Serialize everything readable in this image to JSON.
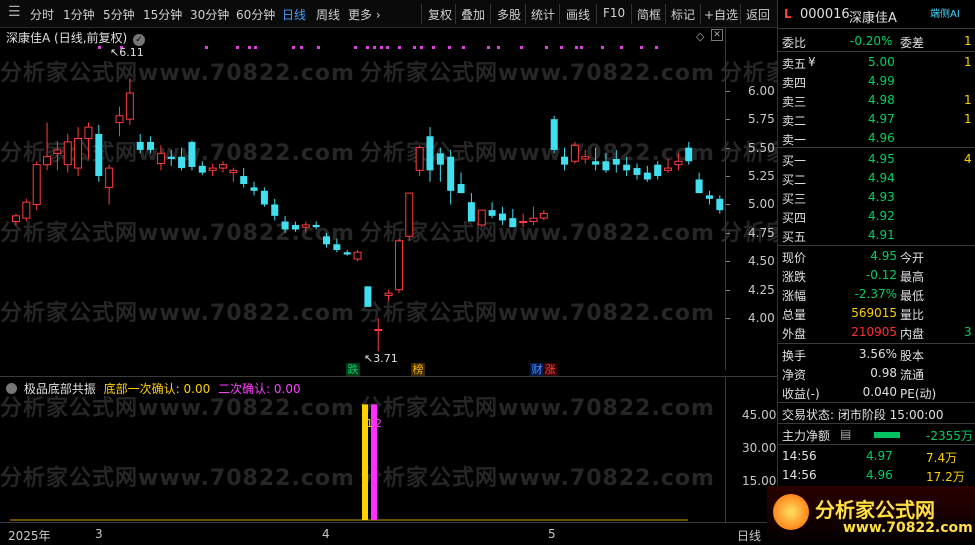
{
  "toolbar": {
    "left": [
      "分时",
      "1分钟",
      "5分钟",
      "15分钟",
      "30分钟",
      "60分钟",
      "日线",
      "周线",
      "更多 ›"
    ],
    "right": [
      "复权",
      "叠加",
      "多股",
      "统计",
      "画线",
      "F10",
      "简框",
      "标记",
      "+自选",
      "返回"
    ],
    "active": "日线"
  },
  "chart_header": {
    "title": "深康佳A (日线,前复权)",
    "badges": [
      {
        "text": "跌",
        "color": "#00c060"
      },
      {
        "text": "榜",
        "color": "#ffa000"
      },
      {
        "text": "财",
        "color": "#4080ff"
      },
      {
        "text": "涨",
        "color": "#ff3030"
      }
    ]
  },
  "price_axis": [
    "6.00",
    "5.75",
    "5.50",
    "5.25",
    "5.00",
    "4.75",
    "4.50",
    "4.25",
    "4.00"
  ],
  "annotations": {
    "high": "6.11",
    "low": "3.71"
  },
  "indicator": {
    "name": "极品底部共振",
    "label1": "底部一次确认: 0.00",
    "label2": "二次确认: 0.00",
    "bar_label1": "1",
    "bar_label2": "2",
    "axis": [
      "45.00",
      "30.00",
      "15.00"
    ],
    "bar_values": [
      50,
      50
    ]
  },
  "time_axis": [
    "2025年",
    "3",
    "4",
    "5"
  ],
  "period_label": "日线",
  "watermark": "分析家公式网www.70822.com",
  "logo": {
    "main": "分析家公式网",
    "url": "www.70822.com"
  },
  "panel": {
    "code_prefix": "L",
    "code": "000016",
    "name": "深康佳A",
    "corner": "端侧AI",
    "weibi_label": "委比",
    "weibi_val": "-0.20%",
    "weicha_label": "委差",
    "weicha_val": "1",
    "sells": [
      {
        "label": "卖五",
        "sym": "¥",
        "price": "5.00",
        "vol": "1"
      },
      {
        "label": "卖四",
        "sym": "",
        "price": "4.99",
        "vol": ""
      },
      {
        "label": "卖三",
        "sym": "",
        "price": "4.98",
        "vol": "1"
      },
      {
        "label": "卖二",
        "sym": "",
        "price": "4.97",
        "vol": "1"
      },
      {
        "label": "卖一",
        "sym": "",
        "price": "4.96",
        "vol": ""
      }
    ],
    "buys": [
      {
        "label": "买一",
        "price": "4.95",
        "vol": "4"
      },
      {
        "label": "买二",
        "price": "4.94",
        "vol": ""
      },
      {
        "label": "买三",
        "price": "4.93",
        "vol": ""
      },
      {
        "label": "买四",
        "price": "4.92",
        "vol": ""
      },
      {
        "label": "买五",
        "price": "4.91",
        "vol": ""
      }
    ],
    "stats": [
      {
        "l1": "现价",
        "v1": "4.95",
        "c1": "green",
        "l2": "今开",
        "v2": ""
      },
      {
        "l1": "涨跌",
        "v1": "-0.12",
        "c1": "green",
        "l2": "最高",
        "v2": ""
      },
      {
        "l1": "涨幅",
        "v1": "-2.37%",
        "c1": "green",
        "l2": "最低",
        "v2": ""
      },
      {
        "l1": "总量",
        "v1": "569015",
        "c1": "yellow",
        "l2": "量比",
        "v2": ""
      },
      {
        "l1": "外盘",
        "v1": "210905",
        "c1": "red",
        "l2": "内盘",
        "v2": "3"
      }
    ],
    "stats2": [
      {
        "l1": "换手",
        "v1": "3.56%",
        "l2": "股本"
      },
      {
        "l1": "净资",
        "v1": "0.98",
        "l2": "流通"
      },
      {
        "l1": "收益(-)",
        "v1": "0.040",
        "l2": "PE(动)"
      }
    ],
    "trade_state": "交易状态: 闭市阶段 15:00:00",
    "main_net_label": "主力净额",
    "main_net_val": "-2355万",
    "ticks": [
      {
        "time": "14:56",
        "price": "4.97",
        "vol": "7.4万"
      },
      {
        "time": "14:56",
        "price": "4.96",
        "vol": "17.2万"
      }
    ]
  },
  "chart_data": {
    "type": "candlestick",
    "ylim": [
      3.65,
      6.2
    ],
    "candles": [
      [
        4.85,
        4.92,
        4.82,
        4.9
      ],
      [
        4.88,
        5.05,
        4.85,
        5.02
      ],
      [
        5.0,
        5.38,
        4.95,
        5.35
      ],
      [
        5.35,
        5.72,
        5.3,
        5.42
      ],
      [
        5.45,
        5.55,
        5.3,
        5.48
      ],
      [
        5.35,
        5.62,
        5.28,
        5.55
      ],
      [
        5.32,
        5.68,
        5.25,
        5.58
      ],
      [
        5.58,
        5.72,
        5.4,
        5.68
      ],
      [
        5.62,
        5.7,
        5.2,
        5.25
      ],
      [
        5.15,
        5.35,
        5.0,
        5.32
      ],
      [
        5.72,
        5.86,
        5.6,
        5.78
      ],
      [
        5.75,
        6.11,
        5.7,
        5.98
      ],
      [
        5.55,
        5.62,
        5.45,
        5.48
      ],
      [
        5.55,
        5.6,
        5.45,
        5.48
      ],
      [
        5.36,
        5.52,
        5.3,
        5.45
      ],
      [
        5.42,
        5.48,
        5.34,
        5.4
      ],
      [
        5.42,
        5.5,
        5.3,
        5.32
      ],
      [
        5.55,
        5.56,
        5.3,
        5.33
      ],
      [
        5.34,
        5.38,
        5.26,
        5.28
      ],
      [
        5.3,
        5.36,
        5.25,
        5.32
      ],
      [
        5.32,
        5.38,
        5.28,
        5.35
      ],
      [
        5.28,
        5.32,
        5.2,
        5.3
      ],
      [
        5.25,
        5.32,
        5.15,
        5.18
      ],
      [
        5.15,
        5.2,
        5.08,
        5.12
      ],
      [
        5.12,
        5.15,
        4.98,
        5.0
      ],
      [
        5.0,
        5.05,
        4.86,
        4.9
      ],
      [
        4.85,
        4.9,
        4.75,
        4.78
      ],
      [
        4.82,
        4.85,
        4.76,
        4.78
      ],
      [
        4.8,
        4.85,
        4.75,
        4.82
      ],
      [
        4.82,
        4.85,
        4.78,
        4.8
      ],
      [
        4.72,
        4.75,
        4.62,
        4.65
      ],
      [
        4.65,
        4.7,
        4.58,
        4.6
      ],
      [
        4.58,
        4.6,
        4.55,
        4.56
      ],
      [
        4.52,
        4.6,
        4.5,
        4.58
      ],
      [
        4.28,
        4.28,
        4.1,
        4.1
      ],
      [
        3.9,
        4.0,
        3.71,
        3.9
      ],
      [
        4.2,
        4.25,
        4.15,
        4.22
      ],
      [
        4.25,
        4.7,
        4.22,
        4.68
      ],
      [
        4.72,
        5.1,
        4.68,
        5.1
      ],
      [
        5.3,
        5.52,
        5.25,
        5.5
      ],
      [
        5.6,
        5.68,
        5.2,
        5.3
      ],
      [
        5.45,
        5.5,
        5.2,
        5.35
      ],
      [
        5.42,
        5.48,
        5.0,
        5.12
      ],
      [
        5.18,
        5.28,
        5.1,
        5.1
      ],
      [
        5.02,
        5.1,
        4.85,
        4.85
      ],
      [
        4.82,
        4.95,
        4.8,
        4.95
      ],
      [
        4.95,
        5.02,
        4.88,
        4.9
      ],
      [
        4.92,
        4.98,
        4.82,
        4.86
      ],
      [
        4.88,
        4.96,
        4.8,
        4.8
      ],
      [
        4.85,
        4.92,
        4.8,
        4.85
      ],
      [
        4.85,
        4.98,
        4.82,
        4.88
      ],
      [
        4.88,
        4.95,
        4.86,
        4.92
      ],
      [
        5.75,
        5.78,
        5.45,
        5.48
      ],
      [
        5.42,
        5.5,
        5.3,
        5.35
      ],
      [
        5.38,
        5.55,
        5.36,
        5.52
      ],
      [
        5.4,
        5.48,
        5.36,
        5.42
      ],
      [
        5.38,
        5.5,
        5.3,
        5.35
      ],
      [
        5.38,
        5.45,
        5.28,
        5.3
      ],
      [
        5.4,
        5.48,
        5.28,
        5.35
      ],
      [
        5.35,
        5.42,
        5.25,
        5.3
      ],
      [
        5.32,
        5.36,
        5.22,
        5.26
      ],
      [
        5.28,
        5.34,
        5.2,
        5.22
      ],
      [
        5.35,
        5.38,
        5.22,
        5.25
      ],
      [
        5.3,
        5.4,
        5.28,
        5.32
      ],
      [
        5.35,
        5.45,
        5.3,
        5.38
      ],
      [
        5.5,
        5.55,
        5.35,
        5.38
      ],
      [
        5.22,
        5.28,
        5.1,
        5.1
      ],
      [
        5.08,
        5.12,
        5.0,
        5.05
      ],
      [
        5.05,
        5.08,
        4.92,
        4.95
      ]
    ]
  }
}
